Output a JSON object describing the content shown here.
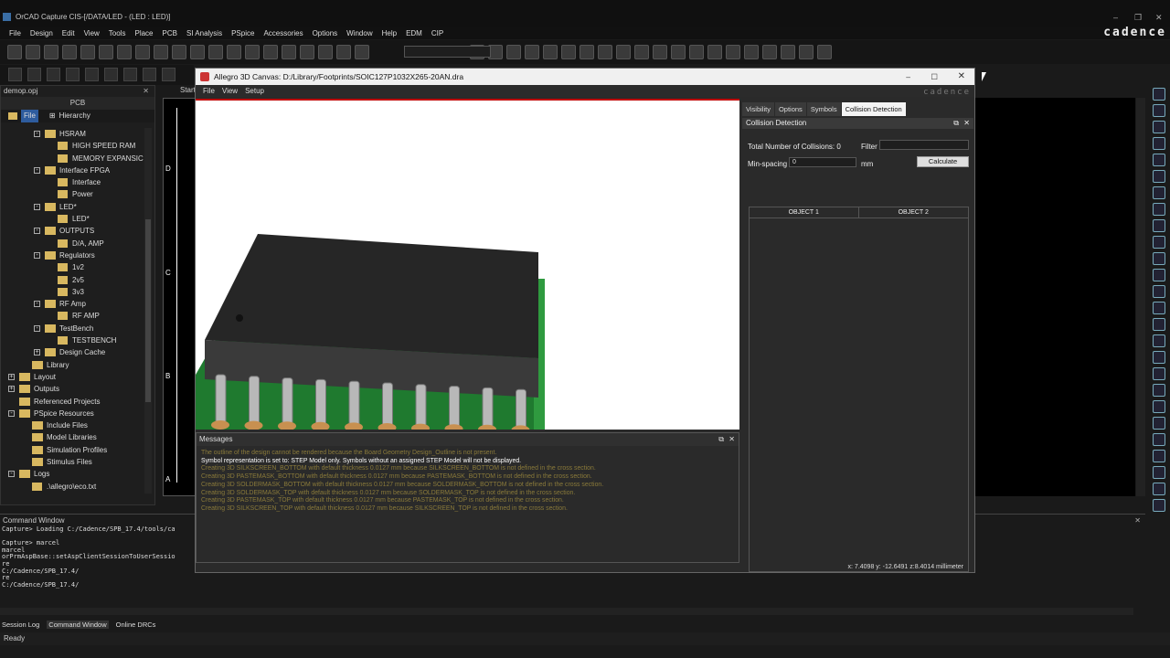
{
  "app": {
    "title": "OrCAD Capture CIS-[/DATA/LED - (LED : LED)]",
    "brand": "cadence",
    "menu": [
      "File",
      "Design",
      "Edit",
      "View",
      "Tools",
      "Place",
      "PCB",
      "SI Analysis",
      "PSpice",
      "Accessories",
      "Options",
      "Window",
      "Help",
      "EDM",
      "CIP"
    ],
    "status": "Ready"
  },
  "project": {
    "file": "demop.opj",
    "panel_title": "PCB",
    "tabs": [
      "File",
      "Hierarchy"
    ],
    "tree": [
      {
        "label": "HSRAM",
        "level": 2,
        "type": "folder",
        "exp": "-"
      },
      {
        "label": "HIGH SPEED RAM",
        "level": 3,
        "type": "page"
      },
      {
        "label": "MEMORY EXPANSIC",
        "level": 3,
        "type": "page"
      },
      {
        "label": "Interface FPGA",
        "level": 2,
        "type": "folder",
        "exp": "-"
      },
      {
        "label": "Interface",
        "level": 3,
        "type": "page"
      },
      {
        "label": "Power",
        "level": 3,
        "type": "page"
      },
      {
        "label": "LED*",
        "level": 2,
        "type": "folder",
        "exp": "-"
      },
      {
        "label": "LED*",
        "level": 3,
        "type": "page"
      },
      {
        "label": "OUTPUTS",
        "level": 2,
        "type": "folder",
        "exp": "-"
      },
      {
        "label": "D/A, AMP",
        "level": 3,
        "type": "page"
      },
      {
        "label": "Regulators",
        "level": 2,
        "type": "folder",
        "exp": "-"
      },
      {
        "label": "1v2",
        "level": 3,
        "type": "page"
      },
      {
        "label": "2v5",
        "level": 3,
        "type": "page"
      },
      {
        "label": "3v3",
        "level": 3,
        "type": "page"
      },
      {
        "label": "RF Amp",
        "level": 2,
        "type": "folder",
        "exp": "-"
      },
      {
        "label": "RF AMP",
        "level": 3,
        "type": "page"
      },
      {
        "label": "TestBench",
        "level": 2,
        "type": "folder",
        "exp": "-"
      },
      {
        "label": "TESTBENCH",
        "level": 3,
        "type": "page"
      },
      {
        "label": "Design Cache",
        "level": 2,
        "type": "folder",
        "exp": "+"
      },
      {
        "label": "Library",
        "level": 1,
        "type": "folder",
        "exp": ""
      },
      {
        "label": "Layout",
        "level": 0,
        "type": "folder",
        "exp": "+"
      },
      {
        "label": "Outputs",
        "level": 0,
        "type": "folder",
        "exp": "+"
      },
      {
        "label": "Referenced Projects",
        "level": 0,
        "type": "folder",
        "exp": ""
      },
      {
        "label": "PSpice Resources",
        "level": 0,
        "type": "folder",
        "exp": "-"
      },
      {
        "label": "Include Files",
        "level": 1,
        "type": "folder",
        "exp": ""
      },
      {
        "label": "Model Libraries",
        "level": 1,
        "type": "folder",
        "exp": ""
      },
      {
        "label": "Simulation Profiles",
        "level": 1,
        "type": "folder",
        "exp": ""
      },
      {
        "label": "Stimulus Files",
        "level": 1,
        "type": "folder",
        "exp": ""
      },
      {
        "label": "Logs",
        "level": 0,
        "type": "folder",
        "exp": "-"
      },
      {
        "label": ".\\allegro\\eco.txt",
        "level": 1,
        "type": "page"
      }
    ],
    "start_tab": "Start"
  },
  "schematic": {
    "border_letters": [
      "D",
      "C",
      "B",
      "A"
    ]
  },
  "command_window": {
    "title": "Command Window",
    "lines": [
      "Capture> Loading C:/Cadence/SPB_17.4/tools/ca",
      "",
      "Capture> marcel",
      "marcel",
      "orPrmAspBase::setAspClientSessionToUserSessio",
      "re",
      "C:/Cadence/SPB_17.4/",
      "re",
      "C:/Cadence/SPB_17.4/"
    ]
  },
  "bottom_tabs": [
    "Session Log",
    "Command Window",
    "Online DRCs"
  ],
  "allegro": {
    "title": "Allegro 3D Canvas: D:/Library/Footprints/SOIC127P1032X265-20AN.dra",
    "menu": [
      "File",
      "View",
      "Setup"
    ],
    "brand": "cadence",
    "messages_title": "Messages",
    "messages": [
      {
        "text": "The outline of the design cannot be rendered because the Board Geometry Design_Outline is not present.",
        "color": "#8a7a3a"
      },
      {
        "text": "Symbol representation is set to: STEP Model only.  Symbols without an assigned STEP Model will not be displayed.",
        "color": "#ffffff"
      },
      {
        "text": "Creating 3D SILKSCREEN_BOTTOM with default thickness 0.0127 mm because SILKSCREEN_BOTTOM is not defined in the cross section.",
        "color": "#8a7a3a"
      },
      {
        "text": "Creating 3D PASTEMASK_BOTTOM with default thickness 0.0127 mm because PASTEMASK_BOTTOM is not defined in the cross section.",
        "color": "#8a7a3a"
      },
      {
        "text": "Creating 3D SOLDERMASK_BOTTOM with default thickness 0.0127 mm because SOLDERMASK_BOTTOM is not defined in the cross section.",
        "color": "#8a7a3a"
      },
      {
        "text": "Creating 3D SOLDERMASK_TOP with default thickness 0.0127 mm because SOLDERMASK_TOP is not defined in the cross section.",
        "color": "#8a7a3a"
      },
      {
        "text": "Creating 3D PASTEMASK_TOP with default thickness 0.0127 mm because PASTEMASK_TOP is not defined in the cross section.",
        "color": "#8a7a3a"
      },
      {
        "text": "Creating 3D SILKSCREEN_TOP with default thickness 0.0127 mm because SILKSCREEN_TOP is not defined in the cross section.",
        "color": "#8a7a3a"
      }
    ],
    "side_tabs": [
      "Visibility",
      "Options",
      "Symbols",
      "Collision Detection"
    ],
    "collision": {
      "title": "Collision Detection",
      "total_label": "Total Number of Collisions: 0",
      "filter_label": "Filter",
      "filter_value": "",
      "minspacing_label": "Min-spacing",
      "minspacing_value": "0",
      "unit": "mm",
      "calculate": "Calculate",
      "columns": [
        "OBJECT 1",
        "OBJECT 2"
      ]
    },
    "coords": "x: 7.4098 y: -12.6491 z:8.4014 millimeter"
  }
}
